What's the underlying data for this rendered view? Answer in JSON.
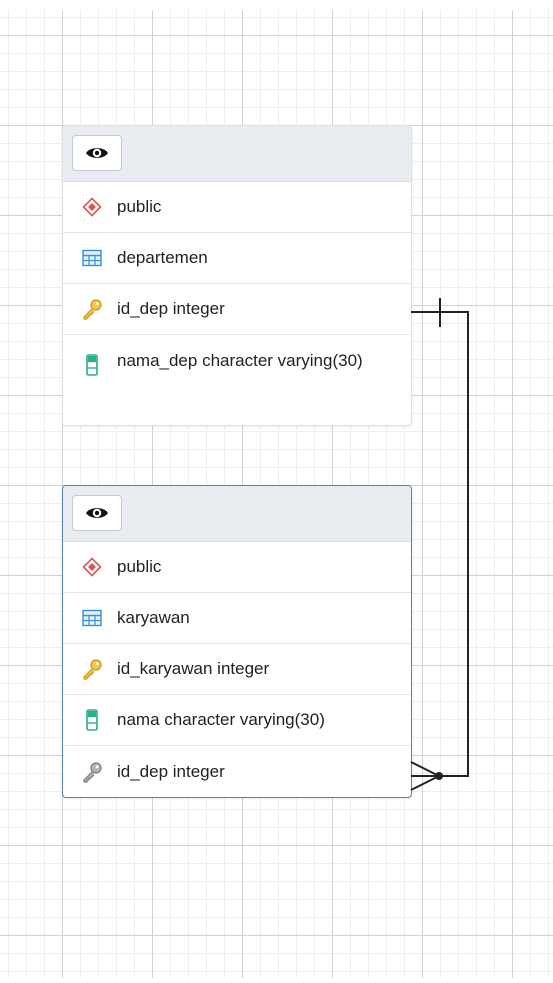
{
  "tables": [
    {
      "id": "departemen",
      "schema_label": "public",
      "table_label": "departemen",
      "columns": [
        {
          "label": "id_dep integer",
          "kind": "primary-key"
        },
        {
          "label": "nama_dep character varying(30)",
          "kind": "column"
        }
      ]
    },
    {
      "id": "karyawan",
      "schema_label": "public",
      "table_label": "karyawan",
      "columns": [
        {
          "label": "id_karyawan integer",
          "kind": "primary-key"
        },
        {
          "label": "nama character varying(30)",
          "kind": "column"
        },
        {
          "label": "id_dep integer",
          "kind": "foreign-key"
        }
      ]
    }
  ],
  "relationship": {
    "from": "karyawan.id_dep",
    "to": "departemen.id_dep",
    "cardinality": "many-to-one"
  },
  "colors": {
    "schema_icon": "#d9534f",
    "table_icon": "#3a8fd4",
    "pk_icon": "#e6b422",
    "column_icon": "#2bae8c",
    "fk_icon": "#8e8e8e",
    "selected_border": "#5a7fa8",
    "relation_line": "#222222"
  }
}
